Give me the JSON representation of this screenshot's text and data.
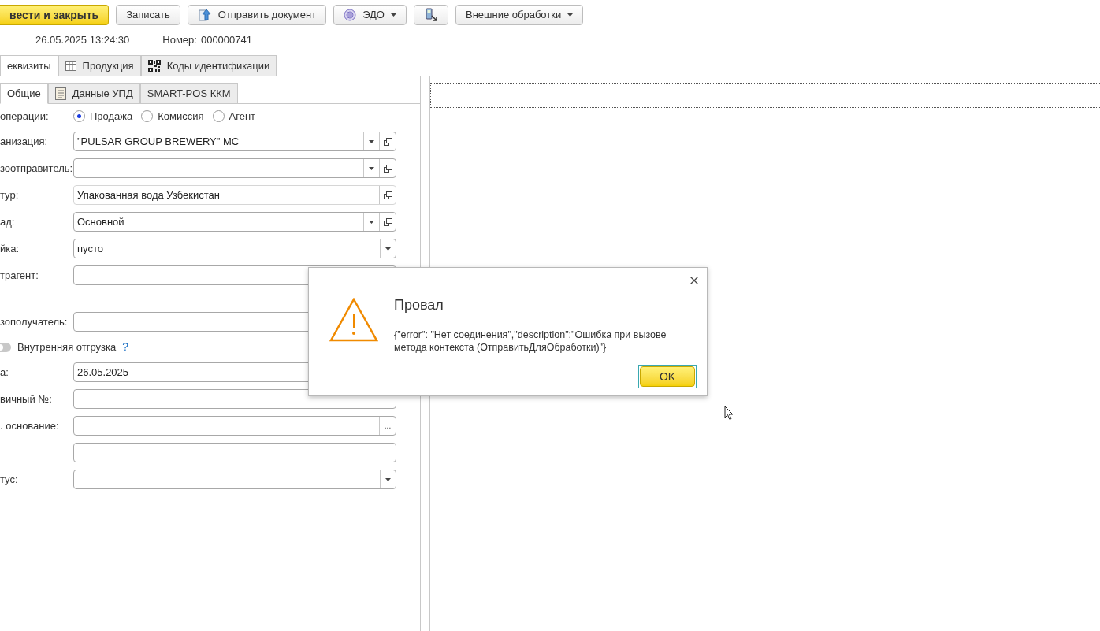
{
  "toolbar": [
    {
      "label": "вести и закрыть",
      "kind": "primary"
    },
    {
      "label": "Записать",
      "kind": "plain"
    },
    {
      "label": "Отправить документ",
      "kind": "send"
    },
    {
      "label": "ЭДО",
      "kind": "edo"
    },
    {
      "kind": "scanner"
    },
    {
      "label": "Внешние обработки",
      "kind": "menu"
    }
  ],
  "header": {
    "date": "26.05.2025 13:24:30",
    "number_label": "Номер:",
    "number": "000000741"
  },
  "tabs": [
    {
      "label": "еквизиты",
      "kind": "plain",
      "selected": true
    },
    {
      "label": "Продукция",
      "kind": "table",
      "selected": false
    },
    {
      "label": "Коды идентификации",
      "kind": "codes",
      "selected": false
    }
  ],
  "subtabs": [
    {
      "label": "Общие",
      "kind": "plain",
      "selected": true
    },
    {
      "label": "Данные УПД",
      "kind": "document",
      "selected": false
    },
    {
      "label": "SMART-POS ККМ",
      "kind": "plain",
      "selected": false
    }
  ],
  "operation": {
    "label": "операции:",
    "options": [
      {
        "label": "Продажа",
        "selected": true
      },
      {
        "label": "Комиссия",
        "selected": false
      },
      {
        "label": "Агент",
        "selected": false
      }
    ]
  },
  "fields": [
    {
      "label": "анизация:",
      "value": "\"PULSAR GROUP BREWERY\" MC",
      "kind": "select_open"
    },
    {
      "label": "зоотправитель:",
      "kind": "select_open"
    },
    {
      "label": "тур:",
      "value": "Упакованная вода Узбекистан",
      "kind": "text_open"
    },
    {
      "label": "ад:",
      "value": "Основной",
      "kind": "select_open"
    },
    {
      "label": "йка:",
      "value": "пусто",
      "kind": "select"
    },
    {
      "label": "трагент:",
      "kind": "text"
    },
    {
      "kind": "spacer"
    },
    {
      "label": "зополучатель:",
      "kind": "text"
    },
    {
      "label": "Внутренняя отгрузка",
      "help": "?",
      "on": false,
      "kind": "toggle"
    },
    {
      "label": "а:",
      "value": "26.05.2025",
      "kind": "text"
    },
    {
      "label": "вичный №:",
      "kind": "text"
    },
    {
      "label": ". основание:",
      "kind": "choice",
      "button_text": "..."
    },
    {
      "kind": "text"
    },
    {
      "label": "тус:",
      "kind": "select"
    }
  ],
  "dialog": {
    "title": "Провал",
    "message": "{\"error\": \"Нет соединения\",\"description\":\"Ошибка при вызове метода контекста (ОтправитьДляОбработки)\"}",
    "button": "OK"
  }
}
